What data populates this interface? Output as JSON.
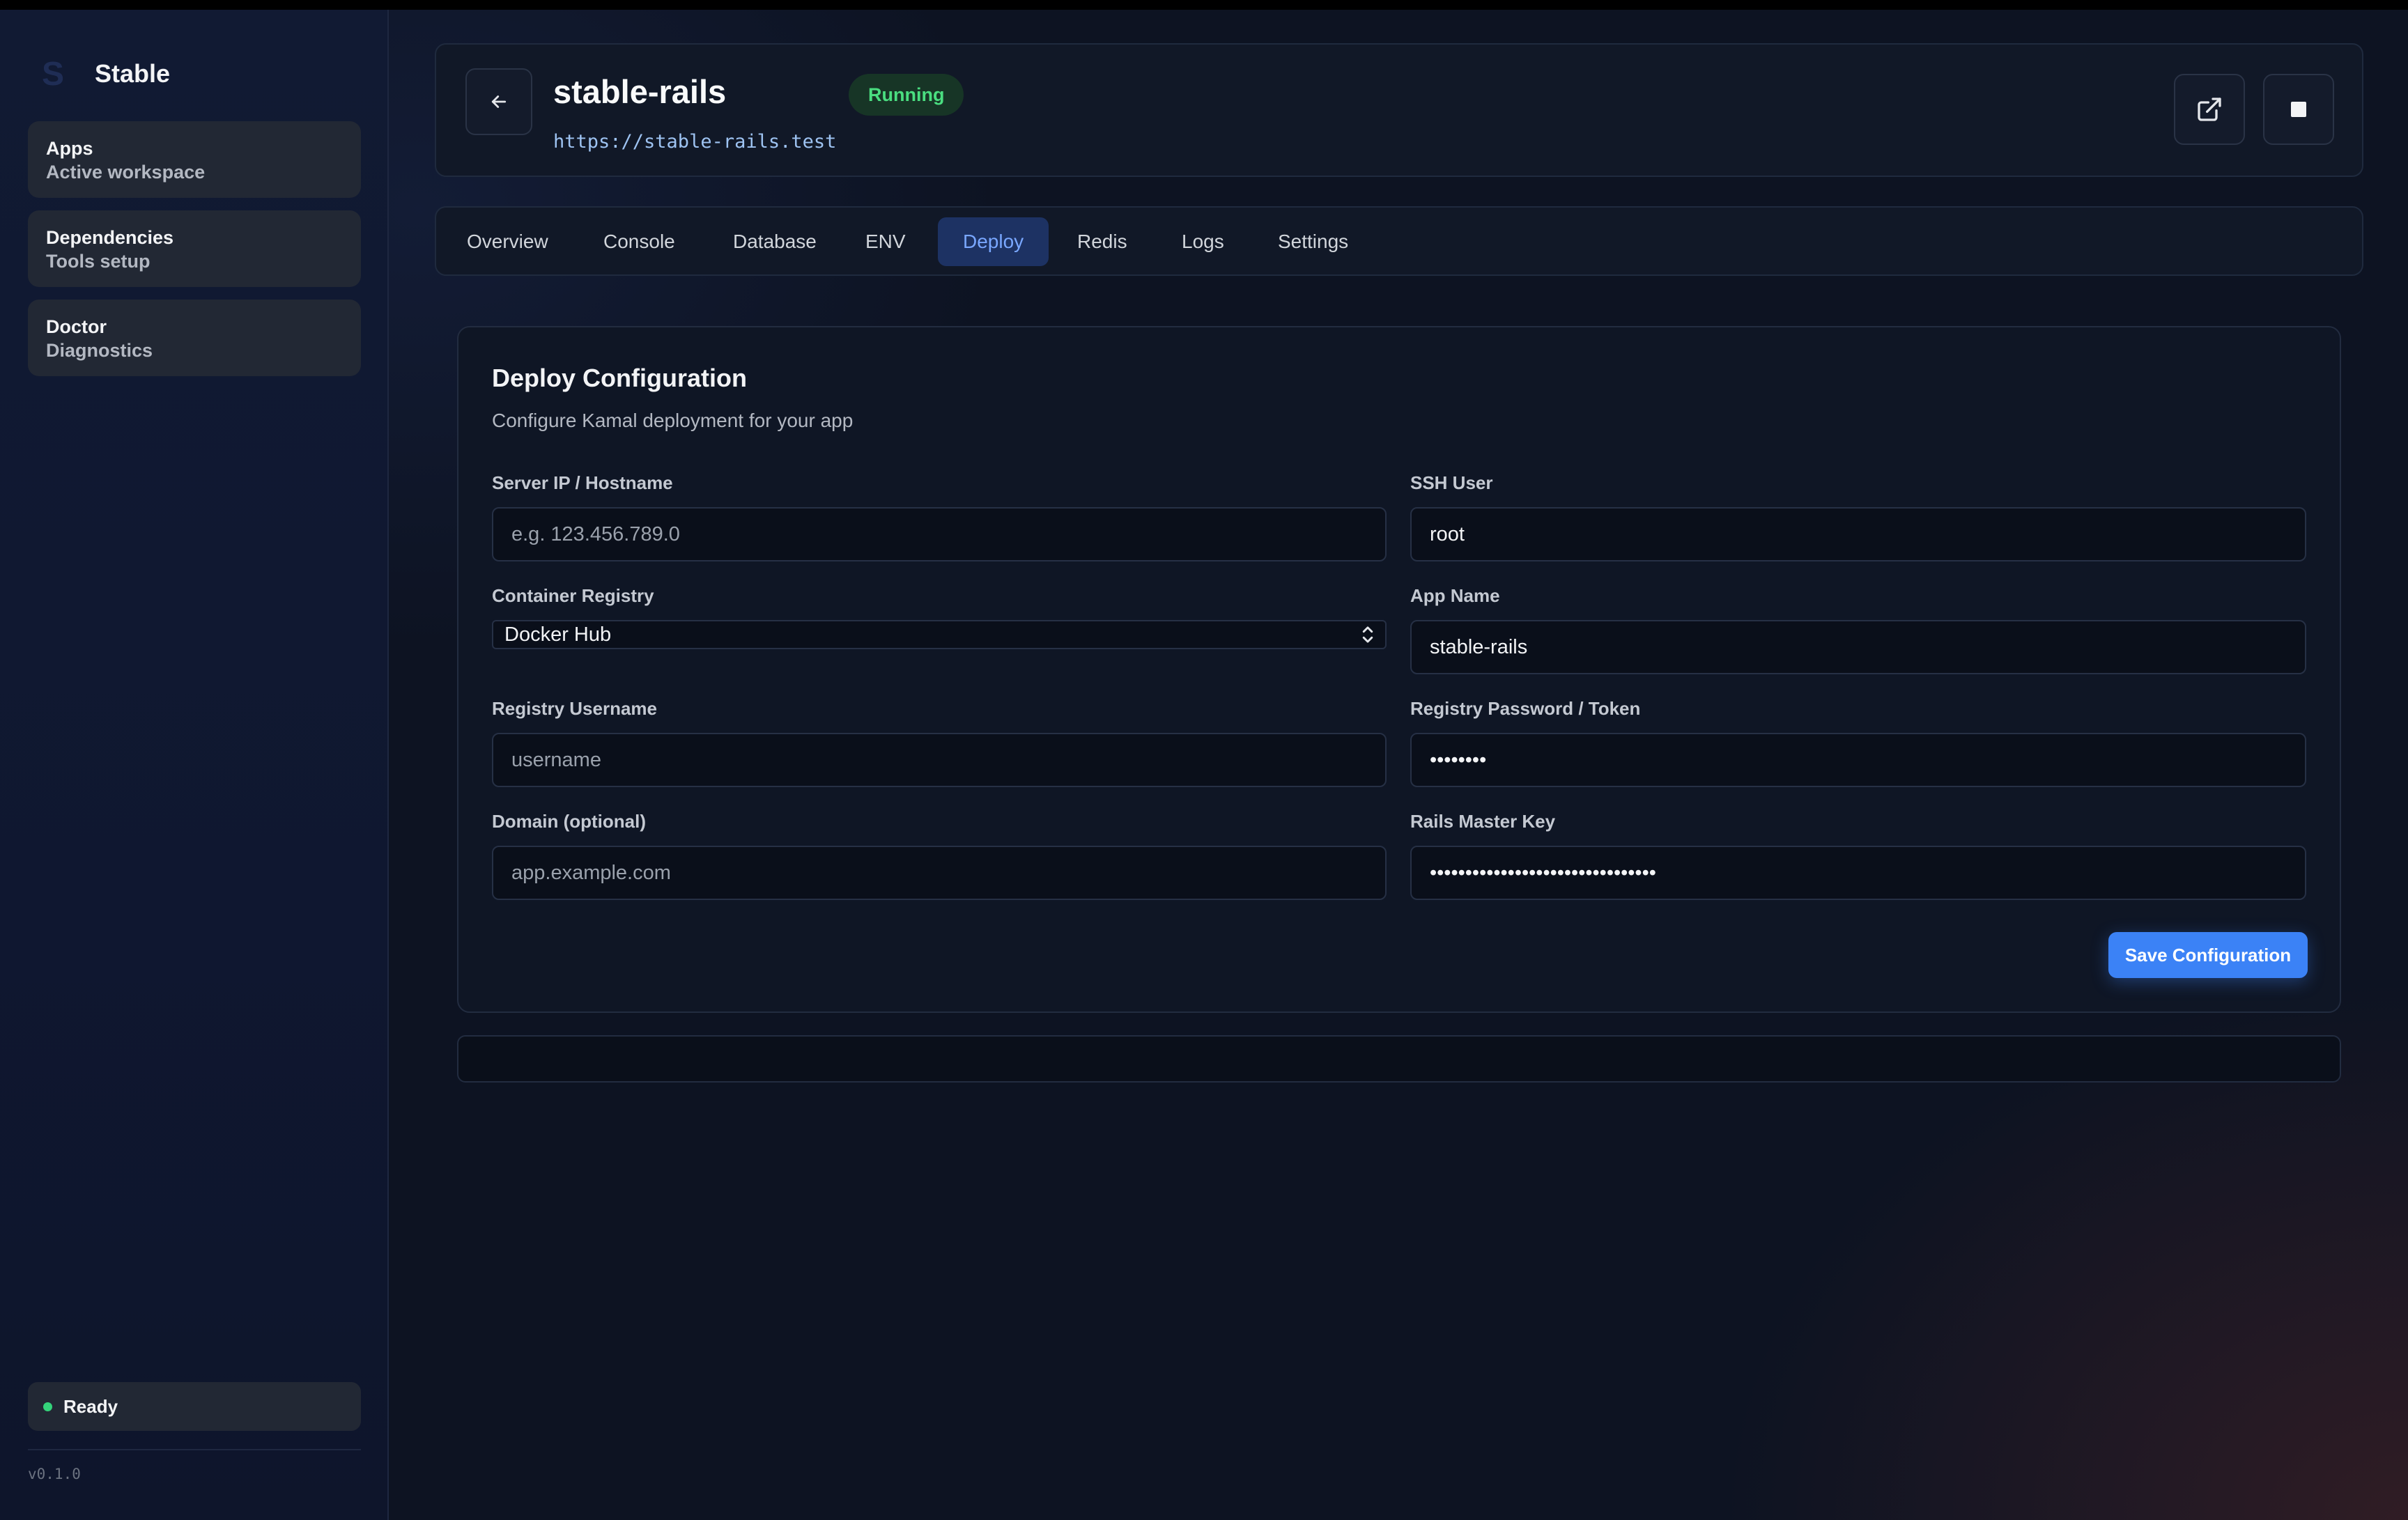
{
  "sidebar": {
    "brand_logo": "S",
    "brand_name": "Stable",
    "items": [
      {
        "title": "Apps",
        "subtitle": "Active workspace"
      },
      {
        "title": "Dependencies",
        "subtitle": "Tools setup"
      },
      {
        "title": "Doctor",
        "subtitle": "Diagnostics"
      }
    ],
    "status": "Ready",
    "version": "v0.1.0"
  },
  "header": {
    "app_name": "stable-rails",
    "status_badge": "Running",
    "url": "https://stable-rails.test",
    "icons": {
      "back": "arrow-left-icon",
      "open": "external-link-icon",
      "stop": "stop-icon"
    }
  },
  "tabs": [
    {
      "label": "Overview",
      "active": false
    },
    {
      "label": "Console",
      "active": false
    },
    {
      "label": "Database",
      "active": false
    },
    {
      "label": "ENV",
      "active": false
    },
    {
      "label": "Deploy",
      "active": true
    },
    {
      "label": "Redis",
      "active": false
    },
    {
      "label": "Logs",
      "active": false
    },
    {
      "label": "Settings",
      "active": false
    }
  ],
  "deploy": {
    "title": "Deploy Configuration",
    "subtitle": "Configure Kamal deployment for your app",
    "server": {
      "label": "Server IP / Hostname",
      "placeholder": "e.g. 123.456.789.0",
      "value": ""
    },
    "ssh_user": {
      "label": "SSH User",
      "value": "root"
    },
    "registry": {
      "label": "Container Registry",
      "value": "Docker Hub"
    },
    "app_name": {
      "label": "App Name",
      "value": "stable-rails"
    },
    "registry_username": {
      "label": "Registry Username",
      "placeholder": "username",
      "value": ""
    },
    "registry_password": {
      "label": "Registry Password / Token",
      "value": "••••••••"
    },
    "domain": {
      "label": "Domain (optional)",
      "placeholder": "app.example.com",
      "value": ""
    },
    "master_key": {
      "label": "Rails Master Key",
      "value": "••••••••••••••••••••••••••••••••"
    },
    "save_label": "Save Configuration"
  },
  "colors": {
    "accent": "#3b82f6",
    "running": "#4ade80",
    "ready_dot": "#34d37a",
    "active_tab_bg": "#1d3263"
  }
}
